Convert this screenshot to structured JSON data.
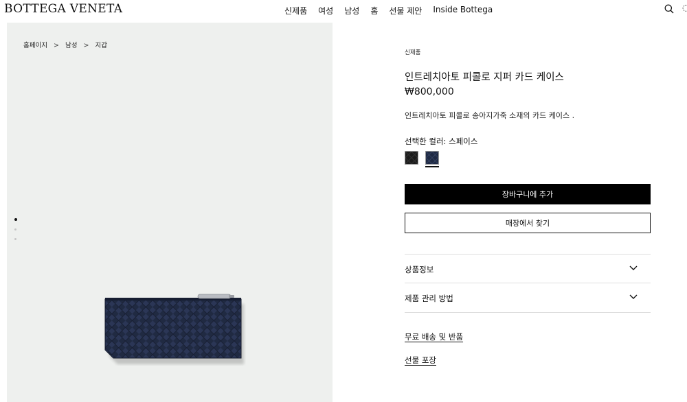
{
  "header": {
    "logo": "BOTTEGA VENETA",
    "nav": [
      "신제품",
      "여성",
      "남성",
      "홈",
      "선물 제안",
      "Inside Bottega"
    ]
  },
  "breadcrumb": [
    "홈페이지",
    "남성",
    "지갑"
  ],
  "breadcrumb_separator": ">",
  "gallery": {
    "image_count": 3,
    "active_index": 0
  },
  "product": {
    "badge": "신제품",
    "title": "인트레치아토 피콜로 지퍼 카드 케이스",
    "price": "₩800,000",
    "description": "인트레치아토 피콜로 송아지가죽 소재의 카드 케이스 .",
    "color_label": "선택한 컬러: 스페이스",
    "swatches": [
      {
        "name": "black",
        "color": "#1c1c1c",
        "selected": false
      },
      {
        "name": "space",
        "color": "#1f2a44",
        "selected": true
      }
    ]
  },
  "actions": {
    "add_to_cart": "장바구니에 추가",
    "find_in_store": "매장에서 찾기"
  },
  "accordion": [
    "상품정보",
    "제품 관리 방법"
  ],
  "links": [
    "무료 배송 및 반품",
    "선물 포장"
  ],
  "colors": {
    "accent": "#000000",
    "panel_bg": "#eef0ee",
    "leather": "#1f2a44"
  }
}
